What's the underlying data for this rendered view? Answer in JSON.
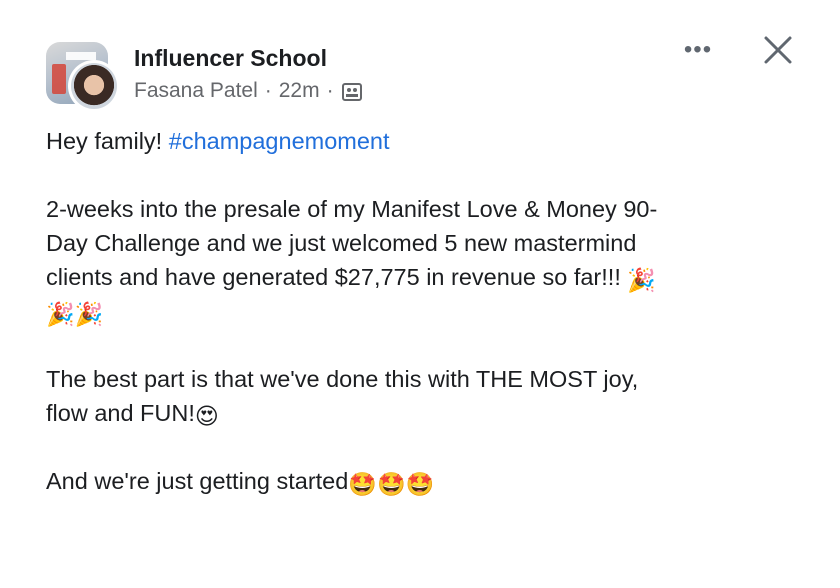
{
  "header": {
    "group_name": "Influencer School",
    "author": "Fasana Patel",
    "time": "22m",
    "separator": "·",
    "more_label": "•••",
    "close_label": "X"
  },
  "post": {
    "greeting": "Hey family! ",
    "hashtag": "#champagnemoment",
    "line2": "2-weeks into the presale of my Manifest Love & Money 90-",
    "line3": "Day Challenge and we just welcomed 5 new mastermind",
    "line4": "clients and have generated $27,775 in revenue so far!!!",
    "party_emoji": "🎉",
    "line6": "The best part is that we've done this with THE MOST joy,",
    "line7": "flow and FUN!",
    "heart_eyes_emoji": "😍",
    "line8": "And we're just getting started",
    "starstruck_emoji": "🤩"
  },
  "colors": {
    "hashtag": "#216fdb",
    "text": "#1c1e21",
    "meta": "#65676b"
  }
}
